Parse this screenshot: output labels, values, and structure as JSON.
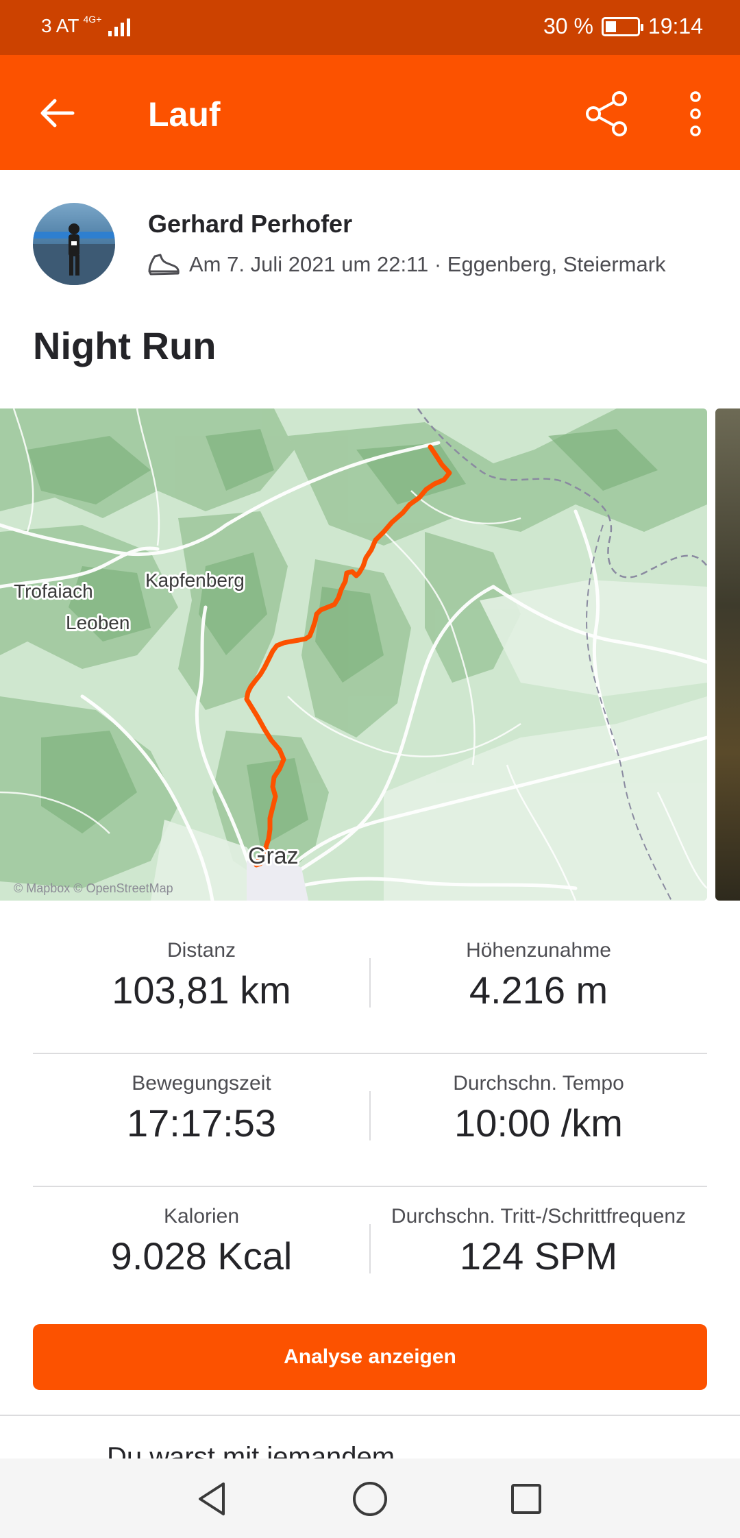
{
  "status_bar": {
    "carrier": "3 AT",
    "network": "4G+",
    "battery": "30 %",
    "time": "19:14"
  },
  "app_bar": {
    "title": "Lauf",
    "background": "#fc5200"
  },
  "activity": {
    "athlete": "Gerhard Perhofer",
    "meta": "Am 7. Juli 2021 um 22:11 · Eggenberg, Steiermark",
    "title": "Night Run",
    "sport_icon": "shoe-icon"
  },
  "map": {
    "labels": {
      "trofaiach": "Trofaiach",
      "leoben": "Leoben",
      "kapfenberg": "Kapfenberg",
      "graz": "Graz"
    },
    "attribution": "© Mapbox © OpenStreetMap",
    "route_color": "#fc5200"
  },
  "stats": [
    {
      "label": "Distanz",
      "value": "103,81 km"
    },
    {
      "label": "Höhenzunahme",
      "value": "4.216 m"
    },
    {
      "label": "Bewegungszeit",
      "value": "17:17:53"
    },
    {
      "label": "Durchschn. Tempo",
      "value": "10:00 /km"
    },
    {
      "label": "Kalorien",
      "value": "9.028 Kcal"
    },
    {
      "label": "Durchschn. Tritt-/Schrittfrequenz",
      "value": "124 SPM"
    }
  ],
  "analyse_button": "Analyse anzeigen",
  "partial_section": "Du warst mit jemandem"
}
